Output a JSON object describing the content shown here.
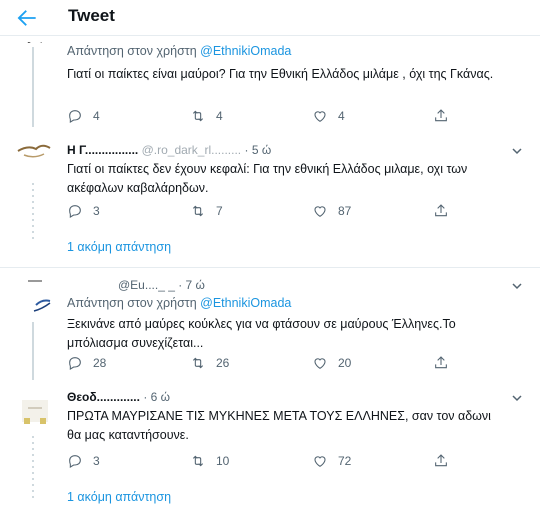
{
  "header": {
    "title": "Tweet",
    "back_icon": "arrow-left-icon",
    "accent": "#1da1f2"
  },
  "colors": {
    "link": "#1b95e0",
    "muted": "#536471",
    "text": "#0f1419",
    "border": "#e6ecf0"
  },
  "tweet_top": {
    "reply_prefix": "Απάντηση στον χρήστη",
    "reply_mention": "@EthnikiOmada",
    "text": "Γιατί οι παίκτες είναι μαύροι? Για την Εθνική Ελλάδος μιλάμε , όχι της Γκάνας.",
    "replies": "4",
    "retweets": "4",
    "likes": "4"
  },
  "tweet_2": {
    "name": "Η Γ................",
    "handle": "@.ro_dark_rl.........",
    "time": "· 5 ώ",
    "text": "Γιατί οι παίκτες δεν έχουν κεφαλί: Για την εθνική Ελλάδος μιλαμε, οχι των ακέφαλων καβαλάρηδων.",
    "replies": "3",
    "retweets": "7",
    "likes": "87",
    "more_replies": "1 ακόμη απάντηση"
  },
  "tweet_3": {
    "handle_time": "@Eu...._ _ · 7 ώ",
    "reply_prefix": "Απάντηση στον χρήστη",
    "reply_mention": "@EthnikiOmada",
    "text": "Ξεκινάνε από μαύρες κούκλες για να φτάσουν σε μαύρους Έλληνες.Το μπόλιασμα συνεχίζεται...",
    "replies": "28",
    "retweets": "26",
    "likes": "20"
  },
  "tweet_4": {
    "name": "Θεοδ.............",
    "time": "· 6 ώ",
    "text": "ΠΡΩΤΑ ΜΑΥΡΙΣΑΝΕ ΤΙΣ ΜΥΚΗΝΕΣ ΜΕΤΑ ΤΟΥΣ ΕΛΛΗΝΕΣ, σαν τον αδωνι θα μας καταντήσουνε.",
    "replies": "3",
    "retweets": "10",
    "likes": "72",
    "more_replies": "1 ακόμη απάντηση"
  }
}
